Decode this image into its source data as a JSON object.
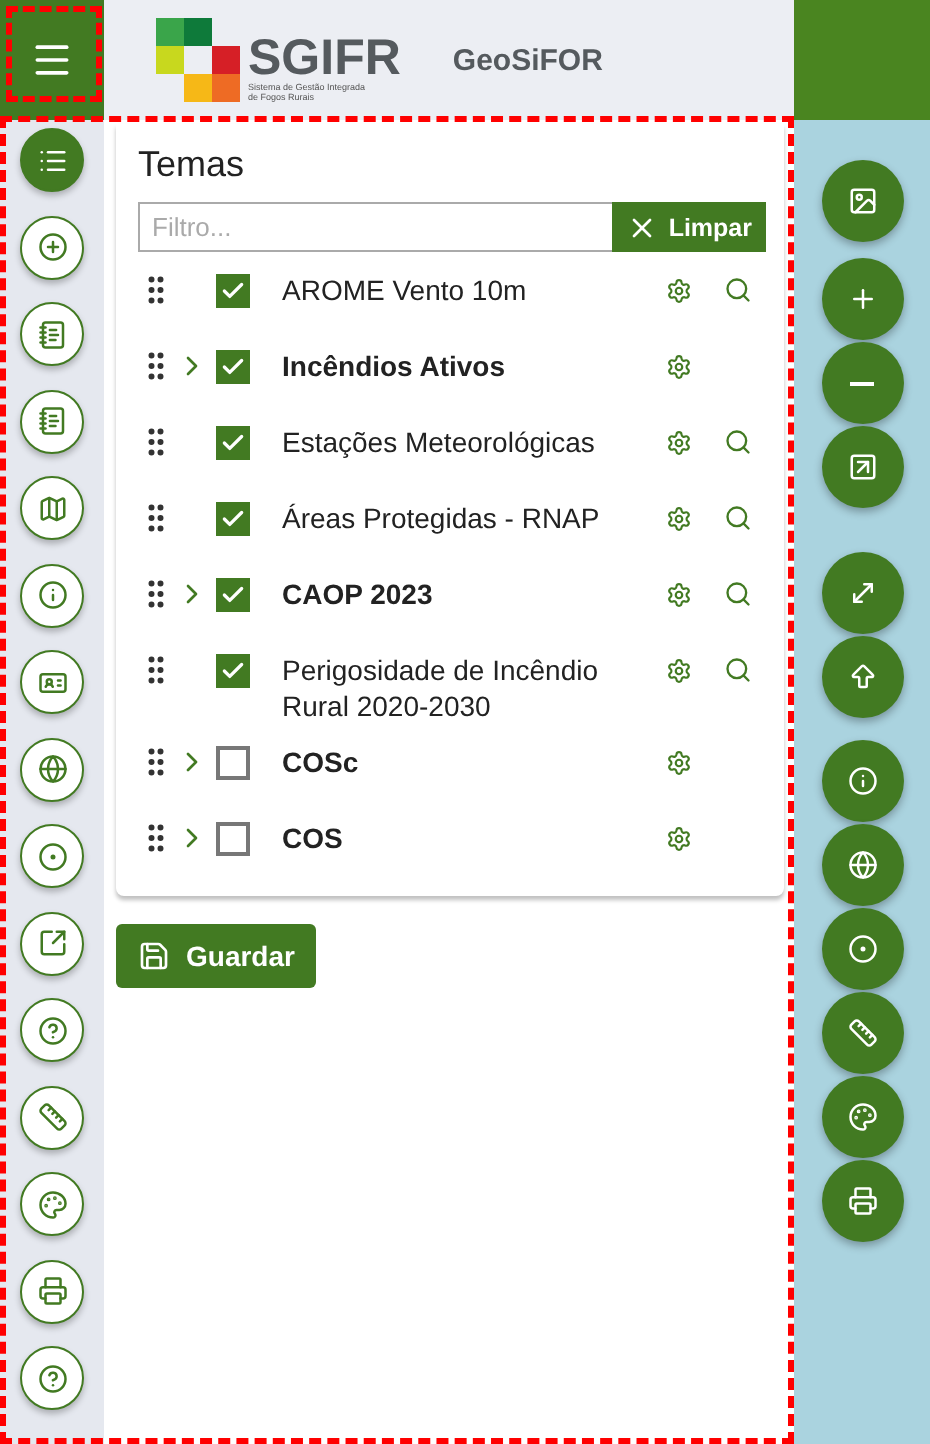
{
  "header": {
    "logo_title": "SGIFR",
    "logo_subtitle": "Sistema de Gestão Integrada de Fogos Rurais",
    "app_title": "GeoSiFOR"
  },
  "sidebar_items": [
    {
      "selected": true
    },
    {
      "selected": false
    },
    {
      "selected": false
    },
    {
      "selected": false
    },
    {
      "selected": false
    },
    {
      "selected": false
    },
    {
      "selected": false
    },
    {
      "selected": false
    },
    {
      "selected": false
    },
    {
      "selected": false
    },
    {
      "selected": false
    },
    {
      "selected": false
    },
    {
      "selected": false
    },
    {
      "selected": false
    },
    {
      "selected": false
    }
  ],
  "panel": {
    "title": "Temas",
    "filter": {
      "placeholder": "Filtro..."
    },
    "clear_button": "Limpar",
    "save_button": "Guardar"
  },
  "layers": [
    {
      "label": "AROME Vento 10m",
      "kind": "layer",
      "checked": true,
      "has_search": true
    },
    {
      "label": "Incêndios Ativos",
      "kind": "group",
      "checked": true,
      "has_search": false
    },
    {
      "label": "Estações Meteorológicas",
      "kind": "layer",
      "checked": true,
      "has_search": true
    },
    {
      "label": "Áreas Protegidas - RNAP",
      "kind": "layer",
      "checked": true,
      "has_search": true
    },
    {
      "label": "CAOP 2023",
      "kind": "group",
      "checked": true,
      "has_search": true
    },
    {
      "label": "Perigosidade de Incêndio Rural 2020-2030",
      "kind": "layer",
      "checked": true,
      "has_search": true
    },
    {
      "label": "COSc",
      "kind": "group",
      "checked": false,
      "has_search": false
    },
    {
      "label": "COS",
      "kind": "group",
      "checked": false,
      "has_search": false
    }
  ]
}
